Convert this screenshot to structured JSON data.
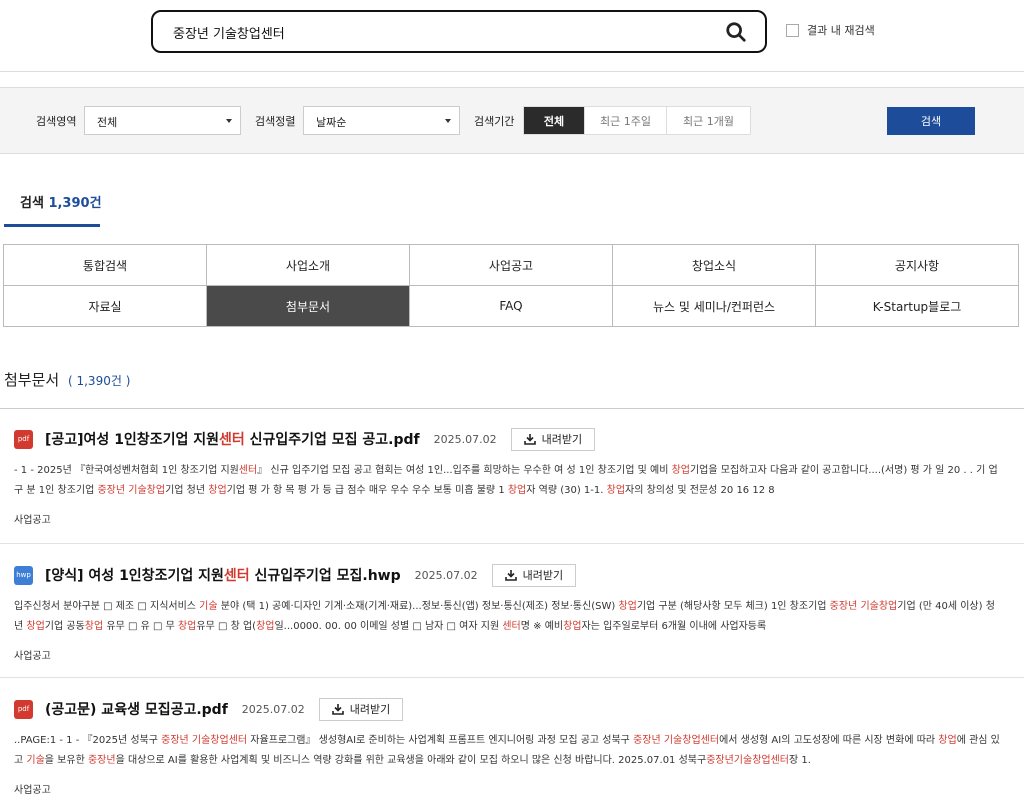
{
  "search": {
    "query": "중장년 기술창업센터",
    "research_label": "결과 내 재검색"
  },
  "filters": {
    "area_label": "검색영역",
    "area_value": "전체",
    "sort_label": "검색정렬",
    "sort_value": "날짜순",
    "period_label": "검색기간",
    "period_options": [
      "전체",
      "최근 1주일",
      "최근 1개월"
    ],
    "search_button": "검색"
  },
  "count_tab": {
    "label": "검색",
    "count": "1,390건"
  },
  "categories": [
    "통합검색",
    "사업소개",
    "사업공고",
    "창업소식",
    "공지사항",
    "자료실",
    "첨부문서",
    "FAQ",
    "뉴스 및 세미나/컨퍼런스",
    "K-Startup블로그"
  ],
  "active_category": "첨부문서",
  "section": {
    "title": "첨부문서",
    "count": "( 1,390건 )"
  },
  "download_label": "내려받기",
  "results": [
    {
      "type": "pdf",
      "title_pre": "[공고]여성 1인창조기업 지원",
      "title_hl": "센터",
      "title_post": " 신규입주기업 모집 공고.pdf",
      "date": "2025.07.02",
      "snippet": "- 1 - 2025년 『한국여성벤처협회 1인 창조기업 지원<b>센터</b>』 신규 입주기업 모집 공고 협회는 여성 1인...입주를 희망하는 우수한 여 성 1인 창조기업 및 예비 <b>창업</b>기업을 모집하고자 다음과 같이 공고합니다....(서명) 평 가 일 20 . . 기 업 구 분 1인 창조기업 <b>중장년 기술창업</b>기업 청년 <b>창업</b>기업 평 가 항 목 평 가 등 급 점수 매우 우수 우수 보통 미흡 불량 1 <b>창업</b>자 역량 (30) 1-1. <b>창업</b>자의 창의성 및 전문성 20 16 12 8",
      "category": "사업공고"
    },
    {
      "type": "hwp",
      "title_pre": "[양식] 여성 1인창조기업 지원",
      "title_hl": "센터",
      "title_post": " 신규입주기업 모집.hwp",
      "date": "2025.07.02",
      "snippet": "입주신청서 분야구분 □ 제조 □ 지식서비스 <b>기술</b> 분야 (택 1) 공예·디자인 기계·소재(기계·재료)...정보·통신(앱) 정보·통신(제조) 정보·통신(SW) <b>창업</b>기업 구분 (해당사항 모두 체크) 1인 창조기업 <b>중장년 기술창업</b>기업 (만 40세 이상) 청년 <b>창업</b>기업 공동<b>창업</b> 유무 □ 유 □ 무 <b>창업</b>유무 □ 창 업(<b>창업</b>일...0000. 00. 00 이메일 성별 □ 남자 □ 여자 지원 <b>센터</b>명 ※ 예비<b>창업</b>자는 입주일로부터 6개월 이내에 사업자등록",
      "category": "사업공고"
    },
    {
      "type": "pdf",
      "title_pre": "(공고문) 교육생 모집공고.pdf",
      "title_hl": "",
      "title_post": "",
      "date": "2025.07.02",
      "snippet": "..PAGE:1 - 1 - 『2025년 성북구 <b>중장년 기술창업센터</b> 자율프로그램』 생성형AI로 준비하는 사업계획 프롬프트 엔지니어링 과정 모집 공고 성북구 <b>중장년 기술창업센터</b>에서 생성형 AI의 고도성장에 따른 시장 변화에 따라 <b>창업</b>에 관심 있고 <b>기술</b>을 보유한 <b>중장년</b>을 대상으로 AI를 활용한 사업계획 및 비즈니스 역량 강화를 위한 교육생을 아래와 같이 모집 하오니 많은 신청 바랍니다. 2025.07.01 성북구<b>중장년기술창업센터</b>장 1.",
      "category": "사업공고"
    }
  ]
}
